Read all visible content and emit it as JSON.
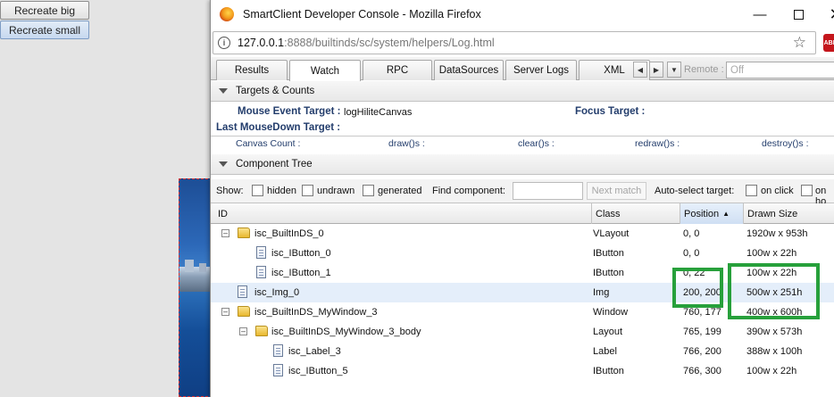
{
  "page": {
    "buttons": {
      "recreate_big": "Recreate big",
      "recreate_small": "Recreate small"
    }
  },
  "window": {
    "title": "SmartClient Developer Console - Mozilla Firefox",
    "url_host": "127.0.0.1",
    "url_rest": ":8888/builtinds/sc/system/helpers/Log.html",
    "addon_badge": "ABP"
  },
  "console": {
    "tabs": [
      {
        "label": "Results"
      },
      {
        "label": "Watch"
      },
      {
        "label": "RPC"
      },
      {
        "label": "DataSources"
      },
      {
        "label": "Server Logs"
      },
      {
        "label": "XML"
      }
    ],
    "selected_tab": "Watch",
    "remote_label": "Remote :",
    "remote_value": "Off",
    "targets_section": "Targets & Counts",
    "mouse_event_label": "Mouse Event Target",
    "mouse_event_value": "logHiliteCanvas",
    "focus_label": "Focus Target",
    "focus_value": "",
    "last_mousedown_label": "Last MouseDown Target",
    "counts": [
      "Canvas Count :",
      "draw()s :",
      "clear()s :",
      "redraw()s :",
      "destroy()s :"
    ],
    "component_section": "Component Tree",
    "show_label": "Show:",
    "show_options": [
      "hidden",
      "undrawn",
      "generated"
    ],
    "find_label": "Find component:",
    "find_value": "",
    "next_match": "Next match",
    "auto_select_label": "Auto-select target:",
    "auto_select_options": [
      "on click",
      "on ho"
    ]
  },
  "tree": {
    "columns": [
      "ID",
      "Class",
      "Position",
      "Drawn Size"
    ],
    "sorted_column": "Position",
    "rows": [
      {
        "id": "isc_BuiltInDS_0",
        "class": "VLayout",
        "position": "0, 0",
        "size": "1920w x 953h"
      },
      {
        "id": "isc_IButton_0",
        "class": "IButton",
        "position": "0, 0",
        "size": "100w x 22h"
      },
      {
        "id": "isc_IButton_1",
        "class": "IButton",
        "position": "0, 22",
        "size": "100w x 22h"
      },
      {
        "id": "isc_Img_0",
        "class": "Img",
        "position": "200, 200",
        "size": "500w x 251h"
      },
      {
        "id": "isc_BuiltInDS_MyWindow_3",
        "class": "Window",
        "position": "760, 177",
        "size": "400w x 600h"
      },
      {
        "id": "isc_BuiltInDS_MyWindow_3_body",
        "class": "Layout",
        "position": "765, 199",
        "size": "390w x 573h"
      },
      {
        "id": "isc_Label_3",
        "class": "Label",
        "position": "766, 200",
        "size": "388w x 100h"
      },
      {
        "id": "isc_IButton_5",
        "class": "IButton",
        "position": "766, 300",
        "size": "100w x 22h"
      }
    ]
  },
  "colors": {
    "highlight_box": "#27a03b",
    "selected_row": "#e4eefa",
    "label_blue": "#233d6c"
  }
}
